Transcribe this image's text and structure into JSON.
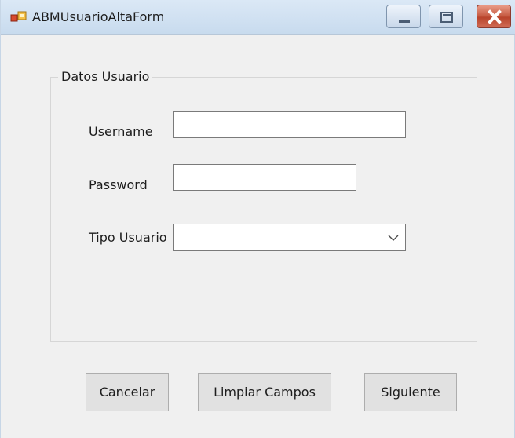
{
  "window": {
    "title": "ABMUsuarioAltaForm",
    "controls": {
      "minimize_icon": "minimize-icon",
      "maximize_icon": "maximize-icon",
      "close_icon": "close-icon"
    }
  },
  "group": {
    "title": "Datos Usuario"
  },
  "form": {
    "username_label": "Username",
    "username_value": "",
    "password_label": "Password",
    "password_value": "",
    "tipo_label": "Tipo Usuario",
    "tipo_value": ""
  },
  "buttons": {
    "cancel": "Cancelar",
    "clear": "Limpiar Campos",
    "next": "Siguiente"
  },
  "colors": {
    "background": "#f0f0f0",
    "title_bar": "#c8dbee",
    "close_button": "#c85f47",
    "button_face": "#e1e1e1"
  }
}
